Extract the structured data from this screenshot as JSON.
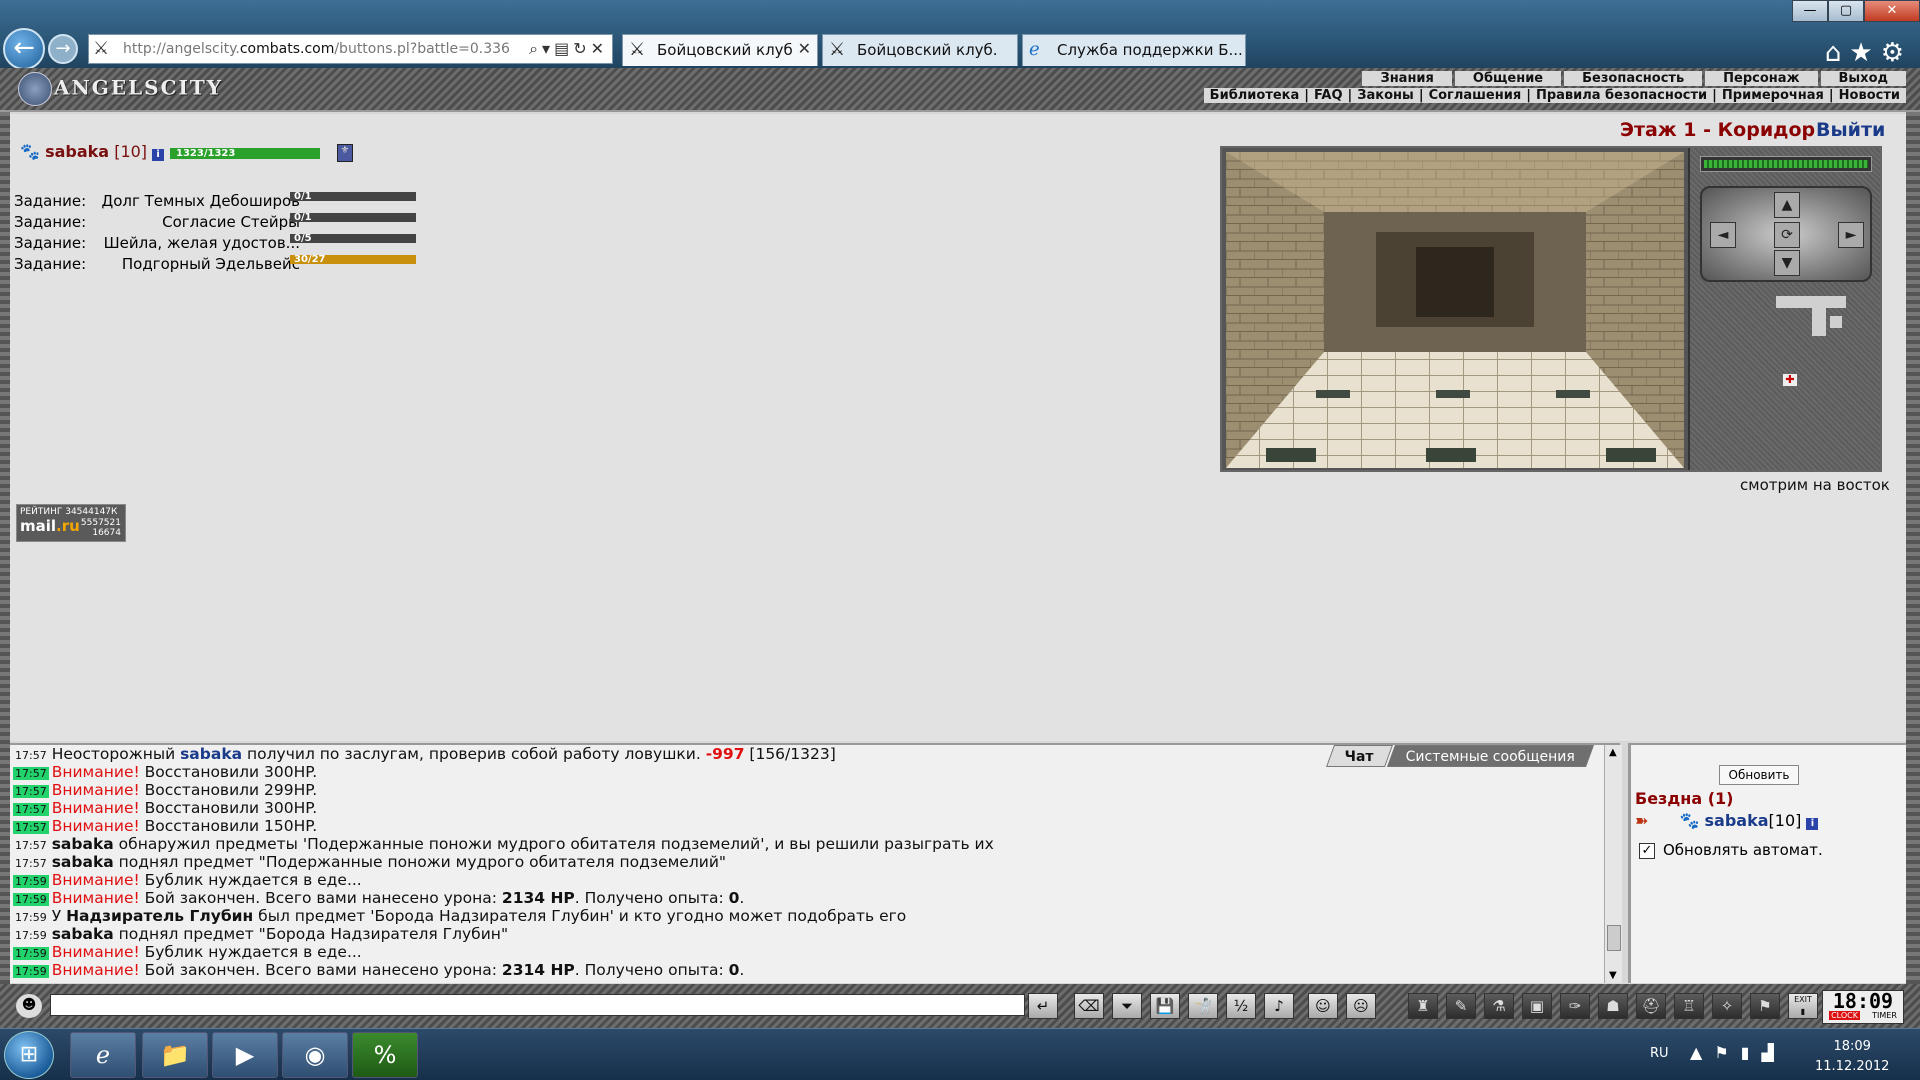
{
  "browser": {
    "url_prefix": "http://angelscity.",
    "url_host": "combats.com",
    "url_path": "/buttons.pl?battle=0.336",
    "tabs": [
      {
        "label": "Бойцовский клуб"
      },
      {
        "label": "Бойцовский клуб."
      },
      {
        "label": "Служба поддержки Б..."
      }
    ],
    "window_controls": {
      "minimize": "—",
      "maximize": "▢",
      "close": "✕"
    }
  },
  "site": {
    "logo": "ANGELSCITY",
    "menu_top": [
      "Знания",
      "Общение",
      "Безопасность",
      "Персонаж",
      "Выход"
    ],
    "menu_bottom": [
      "Библиотека",
      "FAQ",
      "Законы",
      "Соглашения",
      "Правила безопасности",
      "Примерочная",
      "Новости"
    ]
  },
  "character": {
    "name": "sabaka",
    "level": "[10]",
    "hp_text": "1323/1323",
    "hp_fraction": 1.0
  },
  "quests": [
    {
      "label": "Задание:",
      "name": "Долг Темных Дебоширов",
      "progress": "0/1",
      "done": false
    },
    {
      "label": "Задание:",
      "name": "Согласие Стейры",
      "progress": "0/1",
      "done": false
    },
    {
      "label": "Задание:",
      "name": "Шейла, желая удостов...",
      "progress": "0/5",
      "done": false
    },
    {
      "label": "Задание:",
      "name": "Подгорный Эдельвейс",
      "progress": "30/27",
      "done": true
    }
  ],
  "location": {
    "title": "Этаж 1 - Коридор",
    "exit_label": "Выйти",
    "facing": "смотрим на восток"
  },
  "rating": {
    "label": "РЕЙТИНГ",
    "value": "34544147К",
    "brand_a": "mail",
    "brand_b": ".ru",
    "n1": "5557521",
    "n2": "16674"
  },
  "chat": {
    "tab_chat": "Чат",
    "tab_system": "Системные сообщения",
    "messages": [
      {
        "time": "17:57",
        "hl": false,
        "parts": [
          [
            "",
            "Неосторожный "
          ],
          [
            "blue",
            "sabaka"
          ],
          [
            "",
            " получил по заслугам, проверив собой работу ловушки. "
          ],
          [
            "redbold",
            "-997"
          ],
          [
            "",
            " [156/1323]"
          ]
        ]
      },
      {
        "time": "17:57",
        "hl": true,
        "parts": [
          [
            "red",
            "Внимание!"
          ],
          [
            "",
            " Восстановили 300HP."
          ]
        ]
      },
      {
        "time": "17:57",
        "hl": true,
        "parts": [
          [
            "red",
            "Внимание!"
          ],
          [
            "",
            " Восстановили 299HP."
          ]
        ]
      },
      {
        "time": "17:57",
        "hl": true,
        "parts": [
          [
            "red",
            "Внимание!"
          ],
          [
            "",
            " Восстановили 300HP."
          ]
        ]
      },
      {
        "time": "17:57",
        "hl": true,
        "parts": [
          [
            "red",
            "Внимание!"
          ],
          [
            "",
            " Восстановили 150HP."
          ]
        ]
      },
      {
        "time": "17:57",
        "hl": false,
        "parts": [
          [
            "bold",
            "sabaka"
          ],
          [
            "",
            " обнаружил предметы 'Подержанные поножи мудрого обитателя подземелий', и вы решили разыграть их"
          ]
        ]
      },
      {
        "time": "17:57",
        "hl": false,
        "parts": [
          [
            "bold",
            "sabaka"
          ],
          [
            "",
            " поднял предмет \"Подержанные поножи мудрого обитателя подземелий\""
          ]
        ]
      },
      {
        "time": "17:59",
        "hl": true,
        "parts": [
          [
            "red",
            "Внимание!"
          ],
          [
            "",
            " Бублик нуждается в еде..."
          ]
        ]
      },
      {
        "time": "17:59",
        "hl": true,
        "parts": [
          [
            "red",
            "Внимание!"
          ],
          [
            "",
            " Бой закончен. Всего вами нанесено урона: "
          ],
          [
            "bold",
            "2134 HP"
          ],
          [
            "",
            ". Получено опыта: "
          ],
          [
            "bold",
            "0"
          ],
          [
            "",
            "."
          ]
        ]
      },
      {
        "time": "17:59",
        "hl": false,
        "parts": [
          [
            "",
            "У "
          ],
          [
            "bold",
            "Надзиратель Глубин"
          ],
          [
            "",
            " был предмет 'Борода Надзирателя Глубин' и кто угодно может подобрать его"
          ]
        ]
      },
      {
        "time": "17:59",
        "hl": false,
        "parts": [
          [
            "bold",
            "sabaka"
          ],
          [
            "",
            " поднял предмет \"Борода Надзирателя Глубин\""
          ]
        ]
      },
      {
        "time": "17:59",
        "hl": true,
        "parts": [
          [
            "red",
            "Внимание!"
          ],
          [
            "",
            " Бублик нуждается в еде..."
          ]
        ]
      },
      {
        "time": "17:59",
        "hl": true,
        "parts": [
          [
            "red",
            "Внимание!"
          ],
          [
            "",
            " Бой закончен. Всего вами нанесено урона: "
          ],
          [
            "bold",
            "2314 HP"
          ],
          [
            "",
            ". Получено опыта: "
          ],
          [
            "bold",
            "0"
          ],
          [
            "",
            "."
          ]
        ]
      }
    ]
  },
  "online": {
    "refresh_label": "Обновить",
    "room": "Бездна (1)",
    "user_name": "sabaka",
    "user_level": "[10]",
    "auto_refresh_label": "Обновлять автомат.",
    "auto_refresh_checked": "✓"
  },
  "toolbar": {
    "clock_time": "18:09",
    "clock_label": "CLOCK",
    "timer_label": "TIMER",
    "exit_tiny": "EXIT"
  },
  "taskbar": {
    "lang": "RU",
    "time": "18:09",
    "date": "11.12.2012"
  }
}
